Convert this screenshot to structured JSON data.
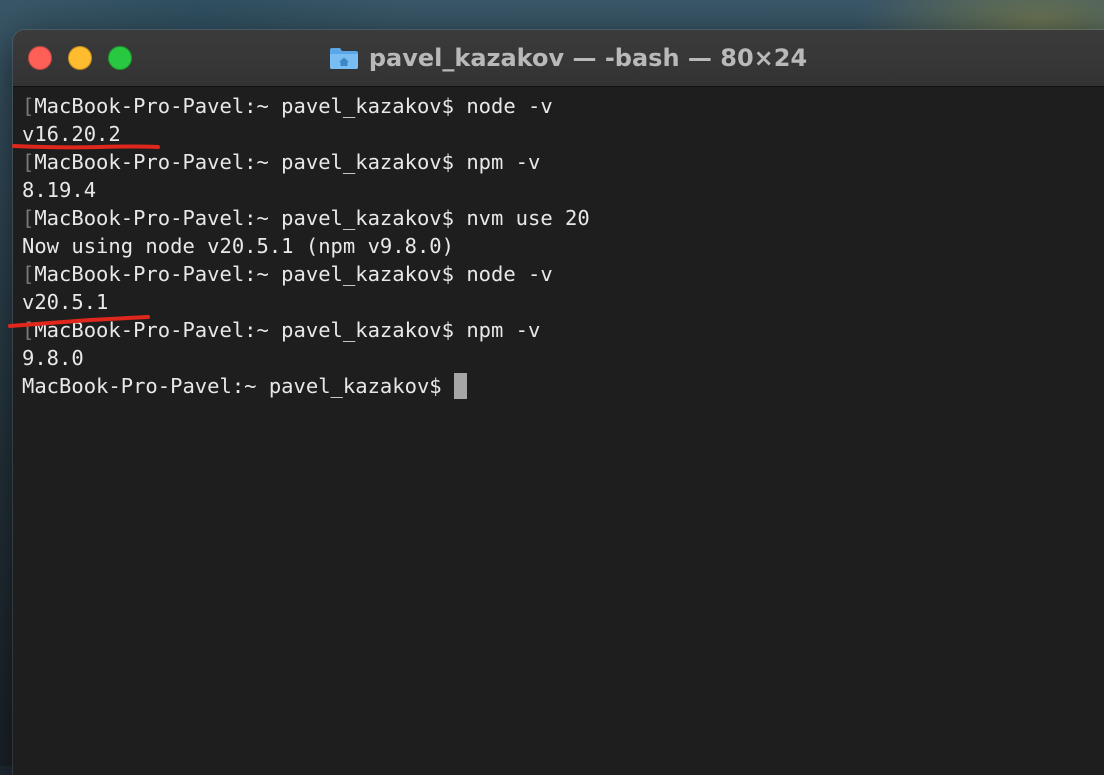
{
  "window": {
    "title": "pavel_kazakov — -bash — 80×24",
    "title_icon": "home-folder-icon",
    "buttons": {
      "close": "close-button",
      "minimize": "minimize-button",
      "zoom": "zoom-button"
    }
  },
  "terminal": {
    "lines": [
      "MacBook-Pro-Pavel:~ pavel_kazakov$ node -v",
      "v16.20.2",
      "MacBook-Pro-Pavel:~ pavel_kazakov$ npm -v",
      "8.19.4",
      "MacBook-Pro-Pavel:~ pavel_kazakov$ nvm use 20",
      "Now using node v20.5.1 (npm v9.8.0)",
      "MacBook-Pro-Pavel:~ pavel_kazakov$ node -v",
      "v20.5.1",
      "MacBook-Pro-Pavel:~ pavel_kazakov$ npm -v",
      "9.8.0",
      "MacBook-Pro-Pavel:~ pavel_kazakov$ "
    ],
    "cursor": "block-cursor"
  },
  "colors": {
    "annotation": "#e0271c",
    "text": "#e8e8e8",
    "background": "#1e1e1e"
  }
}
